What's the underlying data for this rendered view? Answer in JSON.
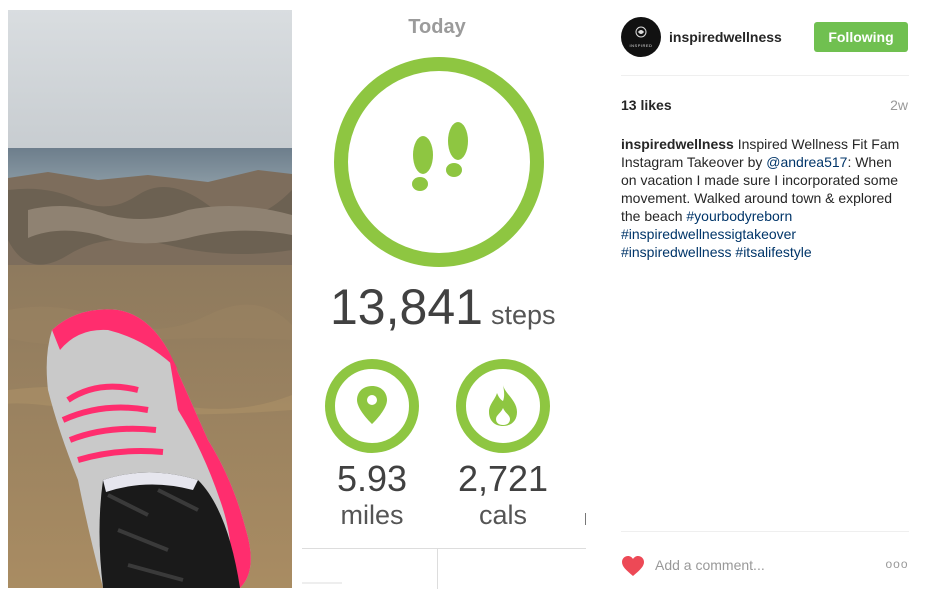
{
  "tracker": {
    "today_label": "Today",
    "steps_value": "13,841",
    "steps_unit": "steps",
    "distance_value": "5.93",
    "distance_unit": "miles",
    "calories_value": "2,721",
    "calories_unit": "cals",
    "accent_color": "#8ec641",
    "steps_icon": "footprints-icon",
    "distance_icon": "map-pin-icon",
    "calories_icon": "flame-icon"
  },
  "photo": {
    "description_icon": "beach-shoe-photo"
  },
  "post": {
    "username": "inspiredwellness",
    "avatar_text": "INSPIRED",
    "follow_label": "Following",
    "follow_color": "#70c050",
    "likes": "13 likes",
    "age": "2w",
    "caption_user": "inspiredwellness",
    "caption_part1": " Inspired Wellness Fit Fam Instagram Takeover by ",
    "mention": "@andrea517",
    "caption_part2": ": When on vacation I made sure I incorporated some movement. Walked around town & explored the beach ",
    "hashtag1": "#yourbodyreborn",
    "hashtag2": "#inspiredwellnessigtakeover",
    "hashtag3": "#inspiredwellness",
    "hashtag4": "#itsalifestyle",
    "comment_placeholder": "Add a comment...",
    "more_label": "ooo",
    "like_icon": "heart-icon"
  }
}
